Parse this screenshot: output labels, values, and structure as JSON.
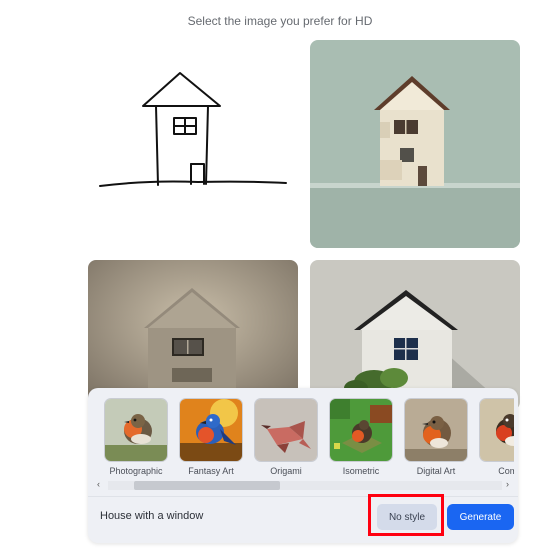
{
  "header": {
    "title": "Select the image you prefer for HD"
  },
  "styles": [
    {
      "label": "Photographic"
    },
    {
      "label": "Fantasy Art"
    },
    {
      "label": "Origami"
    },
    {
      "label": "Isometric"
    },
    {
      "label": "Digital Art"
    },
    {
      "label": "Comic"
    }
  ],
  "prompt": {
    "text": "House with a window"
  },
  "buttons": {
    "no_style": "No style",
    "generate": "Generate"
  },
  "scroll": {
    "left_arrow": "‹",
    "right_arrow": "›"
  },
  "colors": {
    "accent": "#1a66f2",
    "highlight_outline": "#ff0010"
  }
}
